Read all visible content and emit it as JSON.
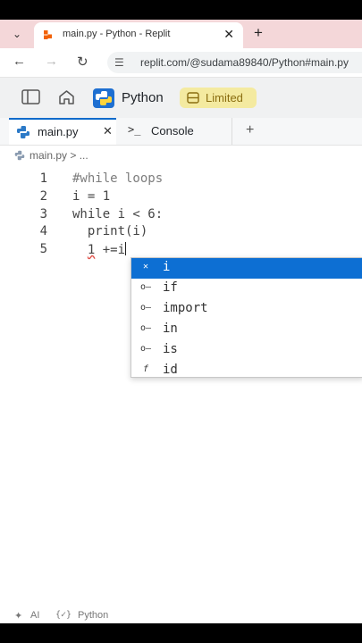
{
  "browser": {
    "tab_title": "main.py - Python - Replit",
    "url": "replit.com/@sudama89840/Python#main.py"
  },
  "replit": {
    "language": "Python",
    "limited_label": "Limited",
    "tabs": {
      "file": "main.py",
      "console": "Console"
    },
    "breadcrumb": {
      "file": "main.py",
      "more": "..."
    }
  },
  "editor": {
    "lines": [
      {
        "num": "1",
        "code": "#while loops"
      },
      {
        "num": "2",
        "code": "i = 1"
      },
      {
        "num": "3",
        "code": "while i < 6:"
      },
      {
        "num": "4",
        "code": "  print(i)"
      },
      {
        "num": "5",
        "code_a": "  ",
        "code_b": "1",
        "code_c": " +=i"
      }
    ]
  },
  "autocomplete": {
    "items": [
      {
        "icon": "variable-icon",
        "label": "i",
        "selected": true
      },
      {
        "icon": "keyword-icon",
        "label": "if"
      },
      {
        "icon": "keyword-icon",
        "label": "import"
      },
      {
        "icon": "keyword-icon",
        "label": "in"
      },
      {
        "icon": "keyword-icon",
        "label": "is"
      },
      {
        "icon": "function-icon",
        "label": "id"
      }
    ]
  },
  "statusbar": {
    "ai": "AI",
    "lang": "Python"
  },
  "colors": {
    "accent": "#0d6fd3",
    "limited_bg": "#f4eaa0",
    "tab_strip": "#f4d7d9"
  }
}
